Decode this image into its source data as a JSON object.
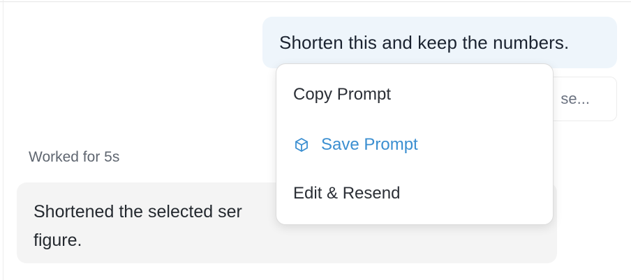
{
  "conversation": {
    "user_message": "Shorten this and keep the numbers.",
    "partially_hidden_card_text": "se...",
    "worked_status": "Worked for 5s",
    "assistant_message": "Shortened the selected ser figure."
  },
  "context_menu": {
    "items": [
      {
        "label": "Copy Prompt",
        "icon": null
      },
      {
        "label": "Save Prompt",
        "icon": "cube-icon",
        "color": "#3b8fd1"
      },
      {
        "label": "Edit & Resend",
        "icon": null
      }
    ]
  },
  "colors": {
    "user_bubble_bg": "#eef5fb",
    "assistant_bubble_bg": "#f4f4f4",
    "accent": "#3b8fd1"
  }
}
